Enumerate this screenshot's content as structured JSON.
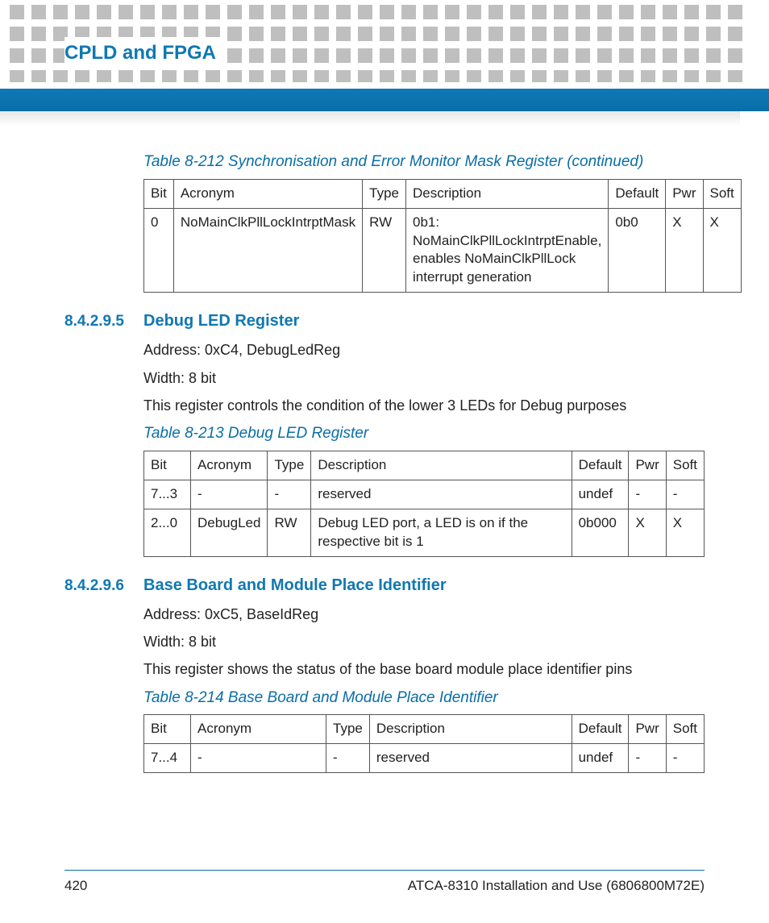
{
  "chapter_title": "CPLD and FPGA",
  "table212": {
    "caption": "Table 8-212 Synchronisation and Error Monitor Mask Register (continued)",
    "headers": [
      "Bit",
      "Acronym",
      "Type",
      "Description",
      "Default",
      "Pwr",
      "Soft"
    ],
    "rows": [
      [
        "0",
        "NoMainClkPllLockIntrptMask",
        "RW",
        "0b1: NoMainClkPllLockIntrptEnable, enables NoMainClkPllLock interrupt generation",
        "0b0",
        "X",
        "X"
      ]
    ]
  },
  "sec5": {
    "num": "8.4.2.9.5",
    "title": "Debug LED Register",
    "address": "Address: 0xC4, DebugLedReg",
    "width": "Width: 8 bit",
    "desc": "This register controls the condition of the lower 3 LEDs for Debug purposes"
  },
  "table213": {
    "caption": "Table 8-213 Debug LED Register",
    "headers": [
      "Bit",
      "Acronym",
      "Type",
      "Description",
      "Default",
      "Pwr",
      "Soft"
    ],
    "rows": [
      [
        "7...3",
        "-",
        "-",
        "reserved",
        "undef",
        "-",
        "-"
      ],
      [
        "2...0",
        "DebugLed",
        "RW",
        "Debug LED port, a LED is on if the respective bit is 1",
        "0b000",
        "X",
        "X"
      ]
    ]
  },
  "sec6": {
    "num": "8.4.2.9.6",
    "title": "Base Board and Module Place Identifier",
    "address": "Address: 0xC5, BaseIdReg",
    "width": "Width: 8 bit",
    "desc": "This register shows the status of the base board module place identifier pins"
  },
  "table214": {
    "caption": "Table 8-214 Base Board and Module Place Identifier",
    "headers": [
      "Bit",
      "Acronym",
      "Type",
      "Description",
      "Default",
      "Pwr",
      "Soft"
    ],
    "rows": [
      [
        "7...4",
        "-",
        "-",
        "reserved",
        "undef",
        "-",
        "-"
      ]
    ]
  },
  "footer": {
    "page": "420",
    "doc": "ATCA-8310 Installation and Use (6806800M72E)"
  },
  "colwidths": {
    "t212": [
      "46px",
      "170px",
      "44px",
      "auto",
      "70px",
      "42px",
      "42px"
    ],
    "t213": [
      "58px",
      "90px",
      "50px",
      "auto",
      "70px",
      "42px",
      "42px"
    ],
    "t214": [
      "58px",
      "168px",
      "50px",
      "auto",
      "70px",
      "42px",
      "42px"
    ]
  }
}
